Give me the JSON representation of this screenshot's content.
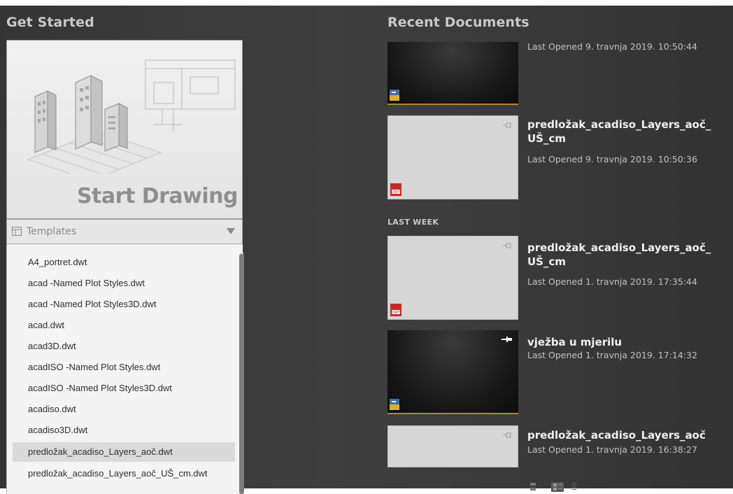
{
  "get_started": {
    "title": "Get Started",
    "start_drawing_label": "Start Drawing",
    "templates_label": "Templates",
    "templates": [
      "A4_portret.dwt",
      "acad -Named Plot Styles.dwt",
      "acad -Named Plot Styles3D.dwt",
      "acad.dwt",
      "acad3D.dwt",
      "acadISO -Named Plot Styles.dwt",
      "acadISO -Named Plot Styles3D.dwt",
      "acadiso.dwt",
      "acadiso3D.dwt",
      "predložak_acadiso_Layers_aoč.dwt",
      "predložak_acadiso_Layers_aoč_UŠ_cm.dwt"
    ],
    "selected_template": "predložak_acadiso_Layers_aoč.dwt"
  },
  "recent": {
    "title": "Recent Documents",
    "section_last_week": "LAST WEEK",
    "docs": [
      {
        "name": "",
        "meta": "Last Opened 9. travnja 2019. 10:50:44",
        "thumb": "dark",
        "icon": "dwg-file-icon",
        "pinned": false
      },
      {
        "name_line1": "predložak_acadiso_Layers_aoč_",
        "name_line2": "UŠ_cm",
        "meta": "Last Opened 9. travnja 2019. 10:50:36",
        "thumb": "light",
        "icon": "dwt-file-icon",
        "pinned": false
      },
      {
        "name_line1": "predložak_acadiso_Layers_aoč_",
        "name_line2": "UŠ_cm",
        "meta": "Last Opened 1. travnja 2019. 17:35:44",
        "thumb": "light",
        "icon": "dwt-file-icon",
        "pinned": false
      },
      {
        "name_line1": "vježba u mjerilu",
        "meta": "Last Opened 1. travnja 2019. 17:14:32",
        "thumb": "dark",
        "icon": "dwg-file-icon",
        "pinned": true
      },
      {
        "name_line1": "predložak_acadiso_Layers_aoč",
        "meta": "Last Opened 1. travnja 2019. 16:38:27",
        "thumb": "light",
        "icon": "dwt-file-icon",
        "pinned": false
      }
    ]
  },
  "colors": {
    "background": "#3a3a3a",
    "accent": "#b0872a",
    "dwt_red": "#c62828"
  }
}
